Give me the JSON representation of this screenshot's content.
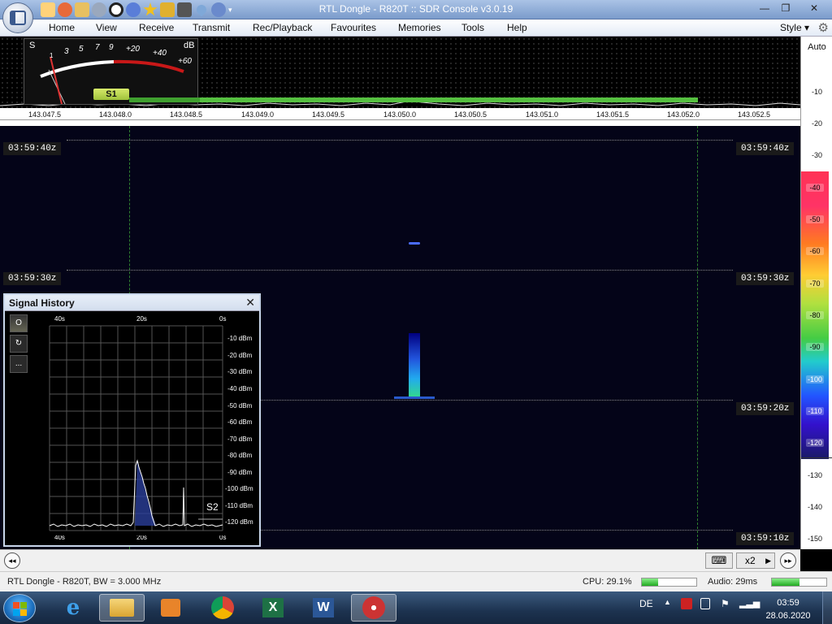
{
  "window": {
    "title": "RTL Dongle - R820T :: SDR Console v3.0.19",
    "minimize_glyph": "—",
    "maximize_glyph": "❐",
    "close_glyph": "✕"
  },
  "quick_access": [
    "home-icon",
    "record-icon",
    "folder-icon",
    "play-icon",
    "stop-icon",
    "add-icon",
    "star-icon",
    "lock-icon",
    "camera-icon",
    "drop-icon",
    "undo-icon",
    "dropdown-icon"
  ],
  "menu": {
    "items": [
      "Home",
      "View",
      "Receive",
      "Transmit",
      "Rec/Playback",
      "Favourites",
      "Memories",
      "Tools",
      "Help"
    ],
    "style_label": "Style",
    "style_glyph": "▾"
  },
  "smeter": {
    "s_label": "S",
    "db_label": "dB",
    "scale_s": [
      "1",
      "3",
      "5",
      "7",
      "9"
    ],
    "scale_db": [
      "+20",
      "+40",
      "+60"
    ],
    "reading": "S1"
  },
  "frequency_axis": [
    "143.047.5",
    "143.048.0",
    "143.048.5",
    "143.049.0",
    "143.049.5",
    "143.050.0",
    "143.050.5",
    "143.051.0",
    "143.051.5",
    "143.052.0",
    "143.052.5"
  ],
  "waterfall": {
    "time_labels": [
      "03:59:40z",
      "03:59:30z",
      "03:59:20z",
      "03:59:10z"
    ]
  },
  "db_scale": {
    "auto_label": "Auto",
    "labels": [
      "-10",
      "-20",
      "-30",
      "-40",
      "-50",
      "-60",
      "-70",
      "-80",
      "-90",
      "-100",
      "-110",
      "-120",
      "-130",
      "-140",
      "-150"
    ]
  },
  "signal_history": {
    "title": "Signal History",
    "close_glyph": "✕",
    "side_buttons": [
      "O",
      "↻",
      "..."
    ],
    "time_labels_top": [
      "40s",
      "20s",
      "0s"
    ],
    "time_labels_bottom": [
      "40s",
      "20s",
      "0s"
    ],
    "dbm_labels": [
      "-10 dBm",
      "-20 dBm",
      "-30 dBm",
      "-40 dBm",
      "-50 dBm",
      "-60 dBm",
      "-70 dBm",
      "-80 dBm",
      "-90 dBm",
      "-100 dBm",
      "-110 dBm",
      "-120 dBm"
    ],
    "s_reading": "S2"
  },
  "bottom_toolbar": {
    "rewind_glyph": "◂◂",
    "keyboard_glyph": "⌨",
    "speed": "x2",
    "speed_arrow": "▶",
    "forward_glyph": "▸▸"
  },
  "status": {
    "device": "RTL Dongle - R820T, BW = 3.000 MHz",
    "cpu": "CPU: 29.1%",
    "cpu_fraction": 0.3,
    "audio": "Audio: 29ms",
    "audio_fraction": 0.5
  },
  "taskbar": {
    "apps": [
      "internet-explorer-icon",
      "file-explorer-icon",
      "media-player-icon",
      "chrome-icon",
      "excel-icon",
      "word-icon",
      "sdr-console-icon"
    ],
    "language": "DE",
    "time": "03:59",
    "date": "28.06.2020"
  },
  "colors": {
    "accent": "#7b9bcb",
    "waterfall_bg": "#040418",
    "signal": "#33dd88"
  }
}
